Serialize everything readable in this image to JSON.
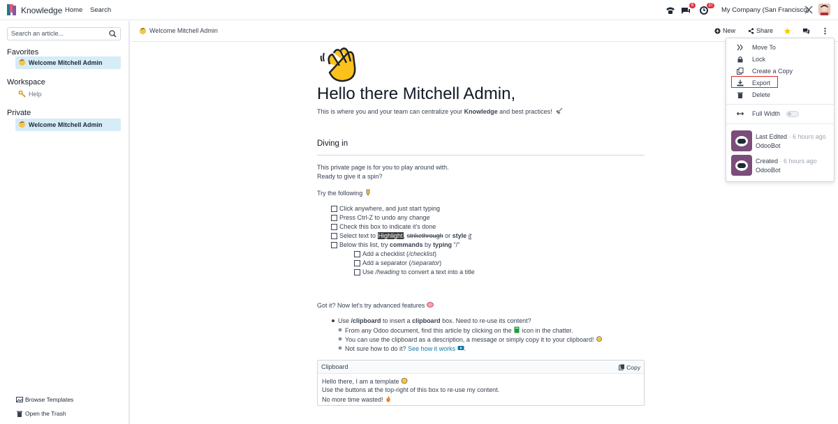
{
  "navbar": {
    "app_name": "Knowledge",
    "links": [
      "Home",
      "Search"
    ],
    "messages_badge": "6",
    "activity_badge": "37",
    "company": "My Company (San Francisco)"
  },
  "sidebar": {
    "search_placeholder": "Search an article...",
    "favorites_title": "Favorites",
    "favorites": [
      "Welcome Mitchell Admin"
    ],
    "workspace_title": "Workspace",
    "workspace": [
      "Help"
    ],
    "private_title": "Private",
    "private": [
      "Welcome Mitchell Admin"
    ],
    "browse_templates": "Browse Templates",
    "open_trash": "Open the Trash"
  },
  "header": {
    "breadcrumb": "Welcome Mitchell Admin",
    "new_label": "New",
    "share_label": "Share"
  },
  "article": {
    "title": "Hello there Mitchell Admin,",
    "lead_pre": "This is where you and your team can centralize your ",
    "lead_bold": "Knowledge",
    "lead_post": " and best practices!",
    "section_title": "Diving in",
    "para1": "This private page is for you to play around with.",
    "para2": "Ready to give it a spin?",
    "try_following": "Try the following",
    "checklist": [
      "Click anywhere, and just start typing",
      "Press Ctrl-Z to undo any change",
      "Check this box to indicate it's done"
    ],
    "select_text": {
      "pre": "Select text to ",
      "highlight": "Highlight",
      "comma": ", ",
      "strike": "strikethrough",
      "or": " or ",
      "style": "style",
      "it": "it"
    },
    "below_list": {
      "pre": "Below this list, try ",
      "commands": "commands",
      "by": " by ",
      "typing": "typing",
      "slash": " \"/\""
    },
    "subchecklist": [
      {
        "pre": "Add a checklist (",
        "em": "/checklist",
        "post": ")"
      },
      {
        "pre": "Add a separator (",
        "em": "/separator",
        "post": ")"
      },
      {
        "pre": "Use ",
        "em": "/heading",
        "post": " to convert a text into a title"
      }
    ],
    "got_it": "Got it? Now let's try advanced features",
    "bullet1": {
      "pre": "Use ",
      "b1": "/clipboard",
      "mid": " to insert a ",
      "b2": "clipboard",
      "post": " box. Need to re-use its content?"
    },
    "sub_bullets": [
      {
        "pre": "From any Odoo document, find this article by clicking on the ",
        "post": " icon in the chatter."
      },
      {
        "text": "You can use the clipboard as a description, a message or simply copy it to your clipboard!"
      },
      {
        "pre": "Not sure how to do it? ",
        "link": "See how it works"
      }
    ],
    "clipboard": {
      "title": "Clipboard",
      "copy_label": "Copy",
      "lines": [
        "Hello there, I am a template",
        "Use the buttons at the top-right of this box to re-use my content.",
        "No more time wasted!"
      ]
    }
  },
  "menu": {
    "items": [
      "Move To",
      "Lock",
      "Create a Copy",
      "Export",
      "Delete"
    ],
    "full_width": "Full Width",
    "full_width_on": false,
    "last_edited_label": "Last Edited",
    "last_edited_time": "· 6 hours ago",
    "last_edited_by": "OdooBot",
    "created_label": "Created",
    "created_time": "· 6 hours ago",
    "created_by": "OdooBot"
  },
  "colors": {
    "accent": "#0d7aa7",
    "active_item": "#d6ecf7",
    "badge": "#dc3545",
    "export_highlight_box": "#e02424"
  }
}
